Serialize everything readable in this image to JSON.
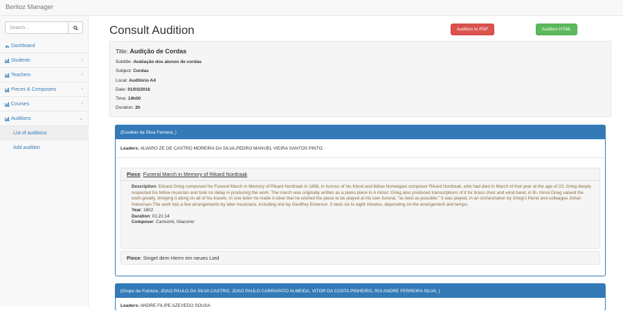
{
  "app": {
    "brand": "Berlioz Manager"
  },
  "search": {
    "placeholder": "Search..."
  },
  "sidebar": {
    "items": [
      {
        "label": "Dashboard",
        "icon": "dashboard-icon"
      },
      {
        "label": "Students",
        "icon": "bar-chart-icon"
      },
      {
        "label": "Teachers",
        "icon": "bar-chart-icon"
      },
      {
        "label": "Pieces & Composers",
        "icon": "bar-chart-icon"
      },
      {
        "label": "Courses",
        "icon": "bar-chart-icon"
      },
      {
        "label": "Auditions",
        "icon": "bar-chart-icon"
      }
    ],
    "subitems": [
      {
        "label": "List of auditions"
      },
      {
        "label": "Add audition"
      }
    ]
  },
  "page": {
    "title": "Consult Audition",
    "pdf_button": "Audition to PDF",
    "html_button": "Audition HTML"
  },
  "audition": {
    "title_label": "Title:",
    "title": "Audição de Cordas",
    "subtitle_label": "Subtitle:",
    "subtitle": "Avaliação dos alunos de cordas",
    "subject_label": "Subject:",
    "subject": "Cordas",
    "local_label": "Local:",
    "local": "Auditório A4",
    "date_label": "Date:",
    "date": "01/03/2016",
    "time_label": "Time:",
    "time": "14h00",
    "duration_label": "Duration:",
    "duration": "2h"
  },
  "groups": [
    {
      "heading": "(Eusébio da Silva Ferreira, )",
      "leaders_label": "Leaders:",
      "leaders": "ALVARO ZE DE CASTRO MOREIRA DA SILVA,PEDRO MANUEL VIEIRA SANTOS PINTO.",
      "pieces": [
        {
          "label": "Piece",
          "name": "Funeral March in Memory of Rikard Nordraak",
          "description_label": "Description",
          "description": "Edvard Grieg composed his Funeral March in Memory of Rikard Nordraak in 1866, in honour of his friend and fellow Norwegian composer Rikard Nordraak, who had died in March of that year at the age of 23. Grieg deeply respected his fellow musician and took no delay in producing the work. The march was originally written as a piano piece in A minor; Grieg also produced transcriptions of it for brass choir and wind band, in B♭ minor.Grieg valued the work greatly, bringing it along on all of his travels. In one letter he made it clear that he wished the piece to be played at his own funeral, \"as best as possible.\" It was played, in an orchestration by Grieg's friend and colleague Johan Halvorsen.The work has a few arrangements by later musicians, including one by Geoffrey Emerson. It lasts six to eight minutes, depending on the arrangement and tempo.",
          "year_label": "Year",
          "year": "1602",
          "duration_label": "Duration",
          "duration": "01:21:14",
          "composer_label": "Composer",
          "composer": "Carissimi, Giacomo"
        },
        {
          "label": "Piece",
          "name": "Singet dem Herrn ein neues Lied"
        }
      ]
    },
    {
      "heading": "(Grupo de Folclore, JOAO PAULO DA SILVA CASTRO, JOAO PAULO CARRAPATO ALMEIDA, VITOR DA COSTA PINHEIRO, RUI ANDRE FERREIRA SILVA, )",
      "leaders_label": "Leaders:",
      "leaders": "ANDRE FILIPE AZEVEDO SOUSA"
    }
  ],
  "colors": {
    "primary": "#337ab7",
    "danger": "#d9534f",
    "success": "#5cb85c"
  }
}
